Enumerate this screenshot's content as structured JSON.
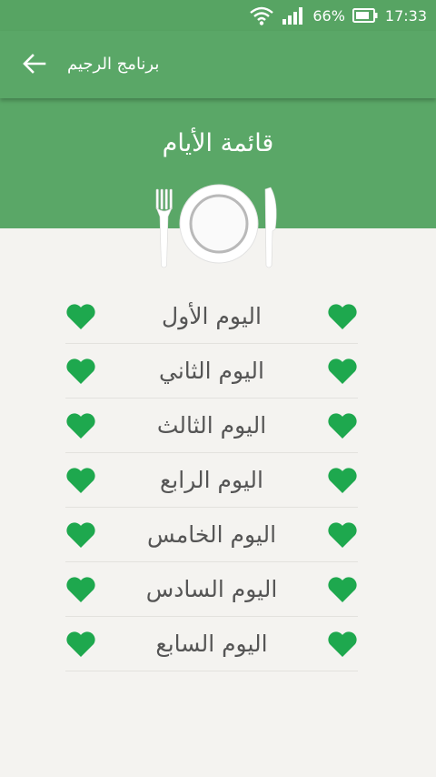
{
  "status_bar": {
    "battery_percent": "66%",
    "time": "17:33",
    "icons": [
      "wifi-icon",
      "signal-icon",
      "battery-icon"
    ]
  },
  "toolbar": {
    "title": "برنامج الرجيم",
    "back_icon": "arrow-left-icon"
  },
  "hero": {
    "title": "قائمة الأيام",
    "icon": "plate-fork-knife-icon"
  },
  "days": [
    {
      "label": "اليوم الأول"
    },
    {
      "label": "اليوم الثاني"
    },
    {
      "label": "اليوم الثالث"
    },
    {
      "label": "اليوم الرابع"
    },
    {
      "label": "اليوم الخامس"
    },
    {
      "label": "اليوم السادس"
    },
    {
      "label": "اليوم السابع"
    }
  ],
  "colors": {
    "primary": "#5aa767",
    "heart": "#1ea84e",
    "background": "#f4f3f0",
    "text": "#555555"
  }
}
